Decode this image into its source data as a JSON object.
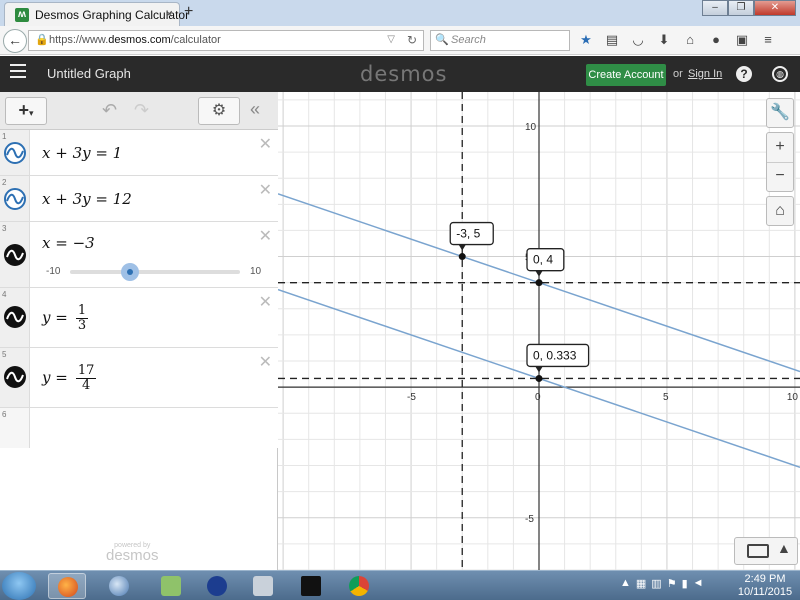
{
  "browser": {
    "tab_title": "Desmos Graphing Calculator",
    "tab_close": "×",
    "new_tab": "+",
    "url_prefix": "https://www.",
    "url_domain": "desmos.com",
    "url_path": "/calculator",
    "search_placeholder": "Search"
  },
  "header": {
    "graph_title": "Untitled Graph",
    "logo": "desmos",
    "create_account": "Create Account",
    "or": "or",
    "sign_in": "Sign In",
    "help": "?"
  },
  "panel": {
    "add_label": "+",
    "expressions": [
      {
        "index": "1",
        "color": "#2d70b3",
        "latex_a": "x + 3y = 1"
      },
      {
        "index": "2",
        "color": "#2d70b3",
        "latex_a": "x + 3y = 12"
      },
      {
        "index": "3",
        "color": "#000000",
        "latex_a": "x = −3",
        "slider_min": "-10",
        "slider_max": "10",
        "slider_value": -3
      },
      {
        "index": "4",
        "color": "#000000",
        "latex_a": "y =",
        "frac_num": "1",
        "frac_den": "3"
      },
      {
        "index": "5",
        "color": "#000000",
        "latex_a": "y =",
        "frac_num": "17",
        "frac_den": "4"
      },
      {
        "index": "6"
      }
    ],
    "powered_by": "powered by",
    "brand": "desmos"
  },
  "graph": {
    "xmin": -10.2,
    "xmax": 10.2,
    "ymin": -7.0,
    "ymax": 11.3,
    "x_ticks": [
      -5,
      0,
      5,
      10
    ],
    "y_ticks": [
      10,
      5,
      -5
    ],
    "x_tick_labels": [
      "-5",
      "0",
      "5",
      "10"
    ],
    "y_tick_labels": [
      "10",
      "5",
      "-5"
    ],
    "lines": [
      {
        "a": 1,
        "b": 3,
        "c": 1,
        "color": "#7aa4cf"
      },
      {
        "a": 1,
        "b": 3,
        "c": 12,
        "color": "#7aa4cf"
      }
    ],
    "dashed_vertical_x": -3,
    "dashed_horizontal_y": [
      4,
      0.333
    ],
    "points": [
      {
        "x": -3,
        "y": 5,
        "label": "-3, 5"
      },
      {
        "x": 0,
        "y": 4,
        "label": "0, 4"
      },
      {
        "x": 0,
        "y": 0.333,
        "label": "0, 0.333"
      }
    ],
    "line_color": "#7aa4cf",
    "grid_color": "#e6e6e6"
  },
  "taskbar": {
    "time": "2:49 PM",
    "date": "10/11/2015"
  }
}
